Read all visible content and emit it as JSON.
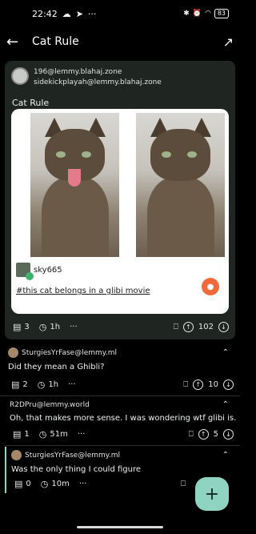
{
  "status_bar": {
    "time": "22:42",
    "battery": "83",
    "icons": [
      "cloud-icon",
      "send-icon",
      "alarm-icon",
      "wifi-icon",
      "battery-icon"
    ]
  },
  "app_bar": {
    "title": "Cat Rule"
  },
  "post": {
    "community": "196@lemmy.blahaj.zone",
    "author": "sidekickplayah@lemmy.blahaj.zone",
    "title": "Cat Rule",
    "embed": {
      "author": "sky665",
      "link_text": "#this cat belongs in a glibi movie"
    },
    "comments": "3",
    "age": "1h",
    "score": "102"
  },
  "comments": [
    {
      "author": "SturgiesYrFase@lemmy.ml",
      "body": "Did they mean a Ghibli?",
      "replies": "2",
      "age": "1h",
      "score": "10"
    },
    {
      "author": "R2DPru@lemmy.world",
      "body": "Oh, that makes more sense. I was wondering wtf glibi is.",
      "replies": "1",
      "age": "51m",
      "score": "5"
    },
    {
      "author": "SturgiesYrFase@lemmy.ml",
      "body": "Was the only thing I could figure",
      "replies": "0",
      "age": "10m",
      "score": ""
    }
  ],
  "colors": {
    "card": "#1f2520",
    "fab": "#8fd4c0",
    "accent_reddit": "#f26a3a"
  }
}
